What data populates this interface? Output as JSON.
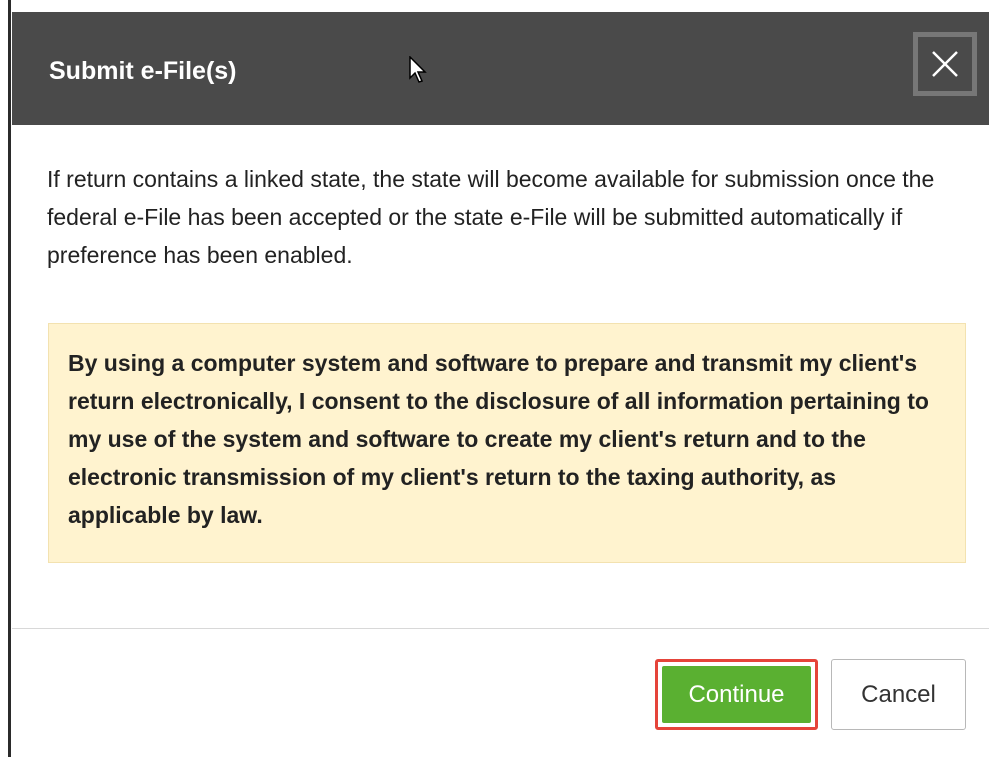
{
  "dialog": {
    "title": "Submit e-File(s)",
    "close_icon": "close-icon",
    "message": "If return contains a linked state, the state will become available for submission once the federal e-File has been accepted or the state e-File will be submitted automatically if preference has been enabled.",
    "consent": "By using a computer system and software to prepare and transmit my client's return electronically, I consent to the disclosure of all information pertaining to my use of the system and software to create my client's return and to the electronic transmission of my client's return to the taxing authority, as applicable by law.",
    "buttons": {
      "continue_label": "Continue",
      "cancel_label": "Cancel"
    }
  },
  "colors": {
    "header_bg": "#4a4a4a",
    "consent_bg": "#fff3cf",
    "primary_button": "#5ab031",
    "highlight_outline": "#e5443a"
  }
}
